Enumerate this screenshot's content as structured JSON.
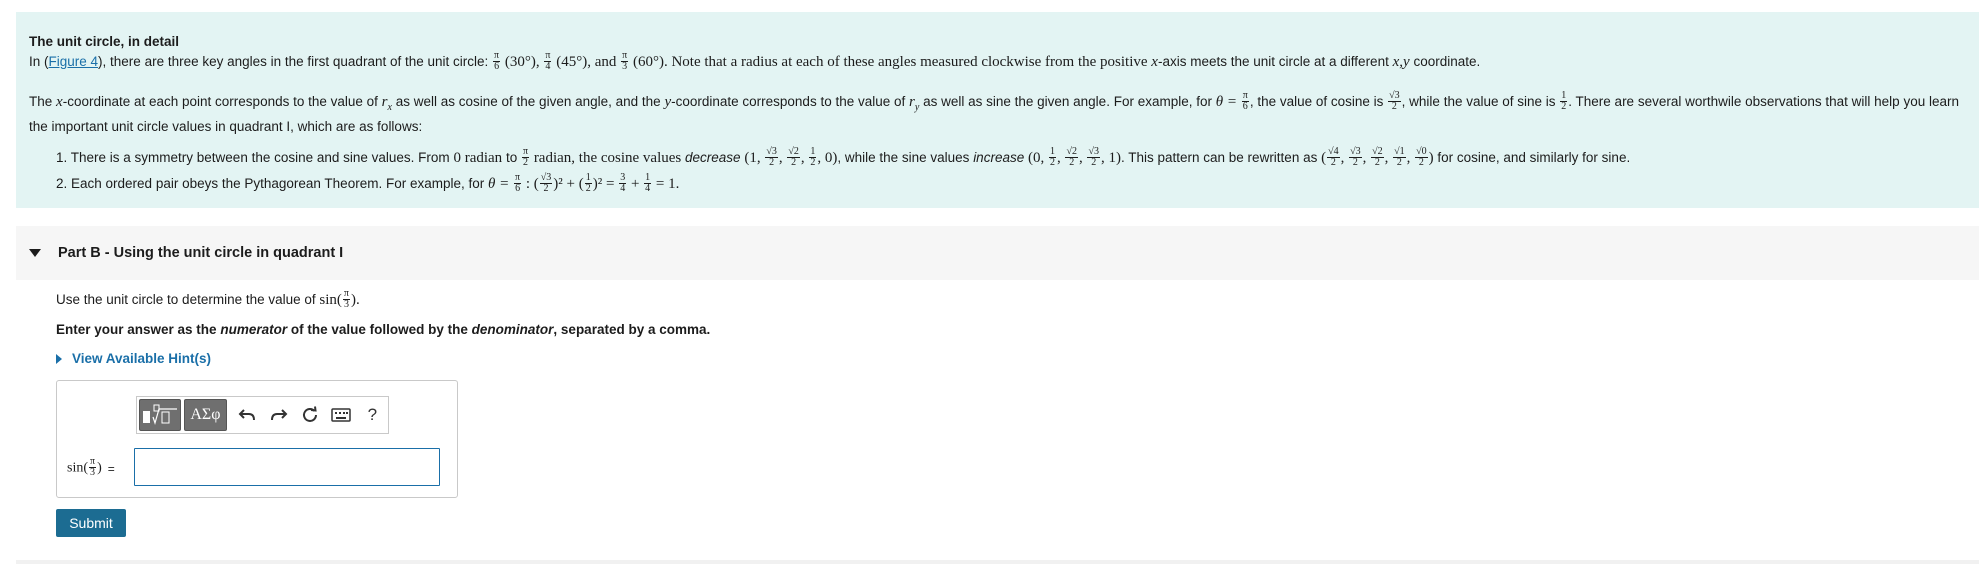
{
  "info": {
    "title": "The unit circle, in detail",
    "p1_a": "In (",
    "p1_link": "Figure 4",
    "p1_b": "), there are three key angles in the first quadrant of the unit circle:",
    "p1_ang1": "(30°),",
    "p1_ang2": "(45°), and",
    "p1_ang3": "(60°). Note that a radius at each of these angles measured clockwise from the positive",
    "p1_x": "x",
    "p1_c": "-axis meets the unit circle at a different",
    "p1_xy": "x,y",
    "p1_d": "coordinate.",
    "p2_a": "The",
    "p2_x": "x",
    "p2_b": "-coordinate at each point corresponds to the value of",
    "p2_rx": "r",
    "p2_rx_sub": "x",
    "p2_c": "as well as cosine of the given angle, and the",
    "p2_y": "y",
    "p2_d": "-coordinate corresponds to the value of",
    "p2_ry": "r",
    "p2_ry_sub": "y",
    "p2_e": "as well as sine the given angle. For example, for",
    "p2_theta": "θ =",
    "p2_f": ", the value of cosine is",
    "p2_g": ", while the value of sine is",
    "p2_h": ". There are several worthwile observations that will help you learn the important unit circle values in quadrant I, which are as follows:",
    "li1_a": "1. There is a symmetry between the cosine and sine values. From",
    "li1_zero": "0 radian",
    "li1_to": "to",
    "li1_radian": "radian, the cosine values",
    "li1_decrease": "decrease",
    "li1_cos_vals": "(1,",
    "li1_b": ", while the sine values",
    "li1_increase": "increase",
    "li1_sin_vals": "(0,",
    "li1_c": ". This pattern can be rewritten as",
    "li1_d": "for cosine, and similarly for sine.",
    "li2_a": "2. Each ordered pair obeys the Pythagorean Theorem. For example, for",
    "li2_theta": "θ =",
    "li2_end": "= 1."
  },
  "fractions": {
    "pi": "π",
    "six": "6",
    "four": "4",
    "three": "3",
    "two": "2",
    "one": "1",
    "r3": "√3",
    "r2": "√2",
    "r4": "√4",
    "r1": "√1",
    "r0": "√0"
  },
  "partb": {
    "title": "Part B - Using the unit circle in quadrant I",
    "question_a": "Use the unit circle to determine the value of",
    "question_fn": "sin",
    "instruction_a": "Enter your answer as the",
    "instruction_num": "numerator",
    "instruction_b": "of the value followed by the",
    "instruction_den": "denominator",
    "instruction_c": ", separated by a comma.",
    "hint": "View Available Hint(s)",
    "toolbar_symbols": "ΑΣφ",
    "toolbar_help": "?",
    "answer_label_fn": "sin",
    "answer_label_eq": "=",
    "answer_value": "",
    "submit": "Submit"
  },
  "colors": {
    "info_bg": "#e3f4f3",
    "link": "#1a6fa8",
    "submit_bg": "#1c6c92"
  }
}
